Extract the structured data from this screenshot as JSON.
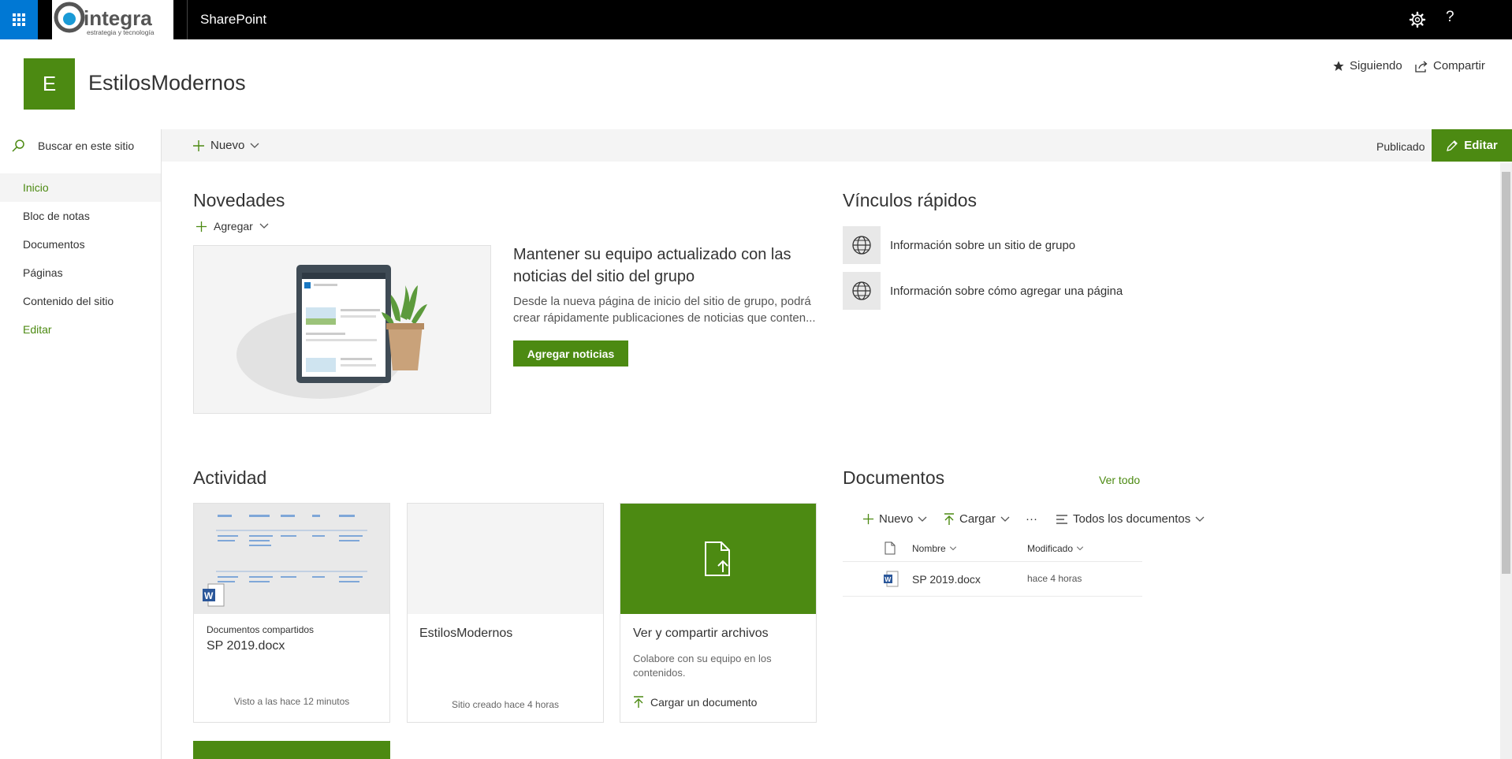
{
  "suite": {
    "app_name": "SharePoint",
    "logo_text": "integra",
    "logo_tagline": "estrategia y tecnología",
    "help_label": "?"
  },
  "site": {
    "logo_letter": "E",
    "title": "EstilosModernos",
    "follow_label": "Siguiendo",
    "share_label": "Compartir"
  },
  "search": {
    "placeholder": "Buscar en este sitio"
  },
  "commandbar": {
    "new_label": "Nuevo",
    "published_label": "Publicado",
    "edit_label": "Editar"
  },
  "nav": {
    "items": [
      {
        "label": "Inicio"
      },
      {
        "label": "Bloc de notas"
      },
      {
        "label": "Documentos"
      },
      {
        "label": "Páginas"
      },
      {
        "label": "Contenido del sitio"
      },
      {
        "label": "Editar"
      }
    ]
  },
  "news": {
    "title": "Novedades",
    "add_label": "Agregar",
    "headline": "Mantener su equipo actualizado con las noticias del sitio del grupo",
    "body": "Desde la nueva página de inicio del sitio de grupo, podrá crear rápidamente publicaciones de noticias que conten...",
    "button": "Agregar noticias"
  },
  "quicklinks": {
    "title": "Vínculos rápidos",
    "items": [
      {
        "label": "Información sobre un sitio de grupo"
      },
      {
        "label": "Información sobre cómo agregar una página"
      }
    ]
  },
  "activity": {
    "title": "Actividad",
    "cards": [
      {
        "category": "Documentos compartidos",
        "title": "SP 2019.docx",
        "footer": "Visto a las hace 12 minutos"
      },
      {
        "title": "EstilosModernos",
        "footer": "Sitio creado hace 4 horas"
      },
      {
        "title": "Ver y compartir archivos",
        "body": "Colabore con su equipo en los contenidos.",
        "action": "Cargar un documento"
      }
    ]
  },
  "documents": {
    "title": "Documentos",
    "see_all": "Ver todo",
    "new_label": "Nuevo",
    "upload_label": "Cargar",
    "more_label": "···",
    "view_label": "Todos los documentos",
    "columns": {
      "name": "Nombre",
      "modified": "Modificado"
    },
    "rows": [
      {
        "name": "SP 2019.docx",
        "modified": "hace 4 horas"
      }
    ]
  },
  "colors": {
    "accent": "#4c8a12",
    "suitebar": "#000000",
    "waffle": "#0078d4"
  }
}
